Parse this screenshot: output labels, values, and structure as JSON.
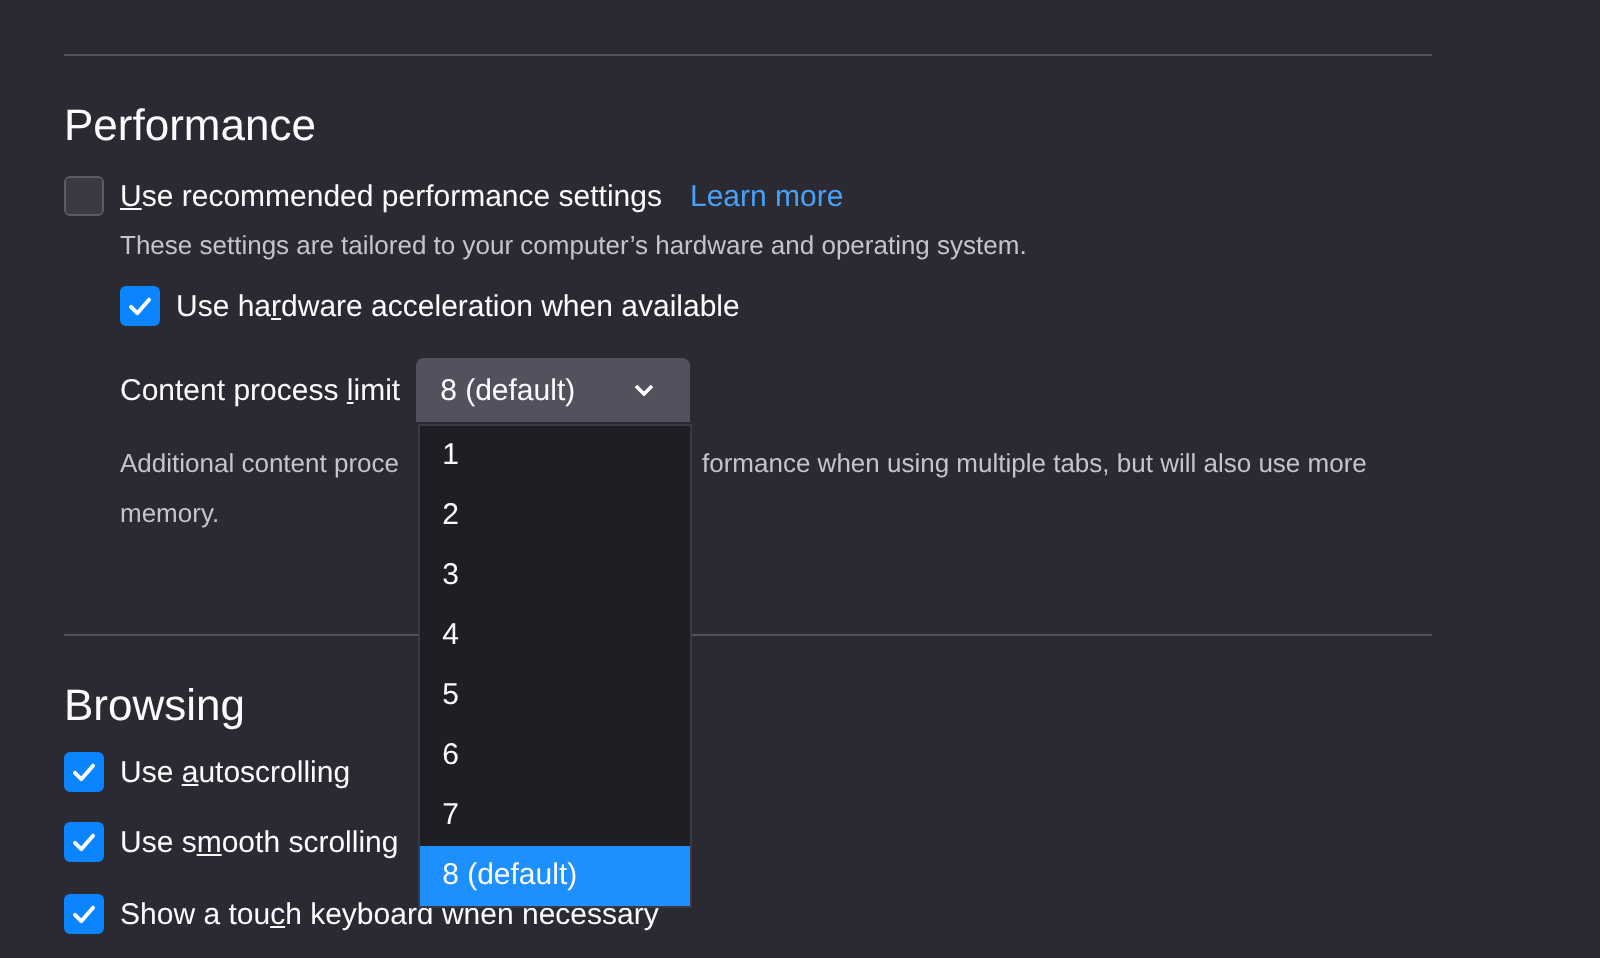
{
  "performance": {
    "heading": "Performance",
    "recommended": {
      "label_parts": {
        "key": "U",
        "after": "se recommended performance settings"
      },
      "checked": false,
      "link": "Learn more"
    },
    "recommended_note": "These settings are tailored to your computer’s hardware and operating system.",
    "hardware": {
      "label_parts": {
        "before": "Use ha",
        "key": "r",
        "after": "dware acceleration when available"
      },
      "checked": true
    },
    "process_limit": {
      "label_parts": {
        "before": "Content process ",
        "key": "l",
        "after": "imit"
      },
      "value": "8 (default)",
      "expanded": true,
      "options": [
        {
          "label": "1",
          "selected": false
        },
        {
          "label": "2",
          "selected": false
        },
        {
          "label": "3",
          "selected": false
        },
        {
          "label": "4",
          "selected": false
        },
        {
          "label": "5",
          "selected": false
        },
        {
          "label": "6",
          "selected": false
        },
        {
          "label": "7",
          "selected": false
        },
        {
          "label": "8 (default)",
          "selected": true
        }
      ]
    },
    "process_note": [
      "Additional content proce",
      "formance when using multiple tabs, but will also use more",
      "memory."
    ]
  },
  "browsing": {
    "heading": "Browsing",
    "options": [
      {
        "label_parts": {
          "before": "Use ",
          "key": "a",
          "after": "utoscrolling"
        },
        "checked": true
      },
      {
        "label_parts": {
          "before": "Use s",
          "key": "m",
          "after": "ooth scrolling"
        },
        "checked": true
      },
      {
        "label_parts": {
          "before": "Show a tou",
          "key": "c",
          "after": "h keyboard when necessary"
        },
        "checked": true
      }
    ]
  }
}
